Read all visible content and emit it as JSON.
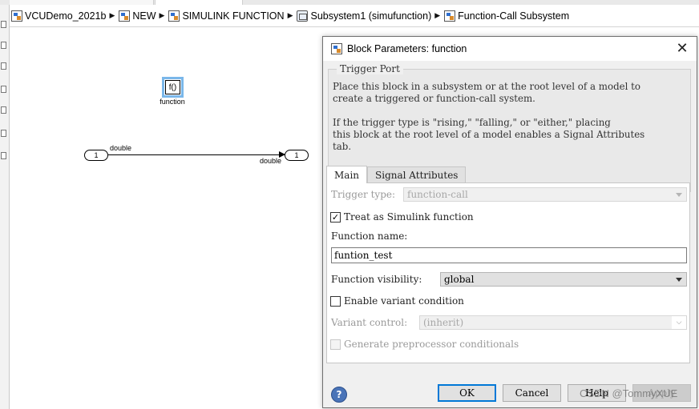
{
  "breadcrumb": [
    {
      "label": "VCUDemo_2021b",
      "icon": "model-icon"
    },
    {
      "label": "NEW",
      "icon": "model-icon"
    },
    {
      "label": "SIMULINK FUNCTION",
      "icon": "model-icon"
    },
    {
      "label": "Subsystem1 (simufunction)",
      "icon": "subsystem-icon"
    },
    {
      "label": "Function-Call Subsystem",
      "icon": "model-icon"
    }
  ],
  "canvas": {
    "function_block": {
      "symbol": "f()",
      "label": "function"
    },
    "inport": {
      "number": "1"
    },
    "outport": {
      "number": "1"
    },
    "signal": {
      "out_type": "double",
      "in_type": "double"
    }
  },
  "dialog": {
    "title": "Block Parameters: function",
    "close_glyph": "✕",
    "group_title": "Trigger Port",
    "description": "Place this block in a subsystem or at the root level of a model to\ncreate a triggered or function-call system.\n\nIf the trigger type is \"rising,\" \"falling,\" or \"either,\" placing\nthis block at the root level of a model enables a Signal Attributes\ntab.",
    "tabs": [
      {
        "label": "Main",
        "active": true
      },
      {
        "label": "Signal Attributes",
        "active": false
      }
    ],
    "trigger_type": {
      "label": "Trigger type:",
      "value": "function-call"
    },
    "treat_as_function": {
      "label": "Treat as Simulink function",
      "checked": true,
      "mark": "✓"
    },
    "function_name": {
      "label": "Function name:",
      "value": "funtion_test"
    },
    "function_visibility": {
      "label": "Function visibility:",
      "value": "global"
    },
    "enable_variant": {
      "label": "Enable variant condition",
      "checked": false
    },
    "variant_control": {
      "label": "Variant control:",
      "value": "(inherit)",
      "button": "⌵"
    },
    "generate_preproc": {
      "label": "Generate preprocessor conditionals",
      "checked": false
    },
    "buttons": {
      "help": "?",
      "ok": "OK",
      "cancel": "Cancel",
      "help_btn": "Help",
      "apply": "Apply"
    }
  },
  "watermark": "CSDN @TommyXUE"
}
